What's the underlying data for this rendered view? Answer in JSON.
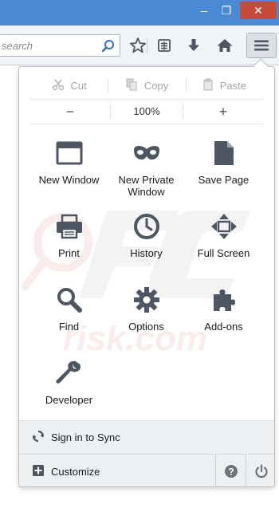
{
  "window": {
    "minimize_glyph": "–",
    "maximize_glyph": "❐",
    "close_glyph": "✕",
    "accent_color": "#4a8ad4",
    "close_color": "#c74b3c"
  },
  "toolbar": {
    "search_placeholder": "search",
    "icons": [
      "magnifier-icon",
      "star-icon",
      "reading-list-icon",
      "download-icon",
      "home-icon",
      "hamburger-menu-icon"
    ]
  },
  "menu": {
    "edit": {
      "cut_label": "Cut",
      "copy_label": "Copy",
      "paste_label": "Paste"
    },
    "zoom": {
      "minus_label": "−",
      "value": "100%",
      "plus_label": "+"
    },
    "items": [
      {
        "label": "New Window",
        "icon": "window-icon"
      },
      {
        "label": "New Private Window",
        "icon": "mask-icon"
      },
      {
        "label": "Save Page",
        "icon": "page-icon"
      },
      {
        "label": "Print",
        "icon": "printer-icon"
      },
      {
        "label": "History",
        "icon": "clock-icon"
      },
      {
        "label": "Full Screen",
        "icon": "fullscreen-arrows-icon"
      },
      {
        "label": "Find",
        "icon": "magnifier-icon"
      },
      {
        "label": "Options",
        "icon": "gear-icon"
      },
      {
        "label": "Add-ons",
        "icon": "puzzle-icon"
      },
      {
        "label": "Developer",
        "icon": "wrench-icon"
      }
    ],
    "sync_label": "Sign in to Sync",
    "customize_label": "Customize"
  }
}
